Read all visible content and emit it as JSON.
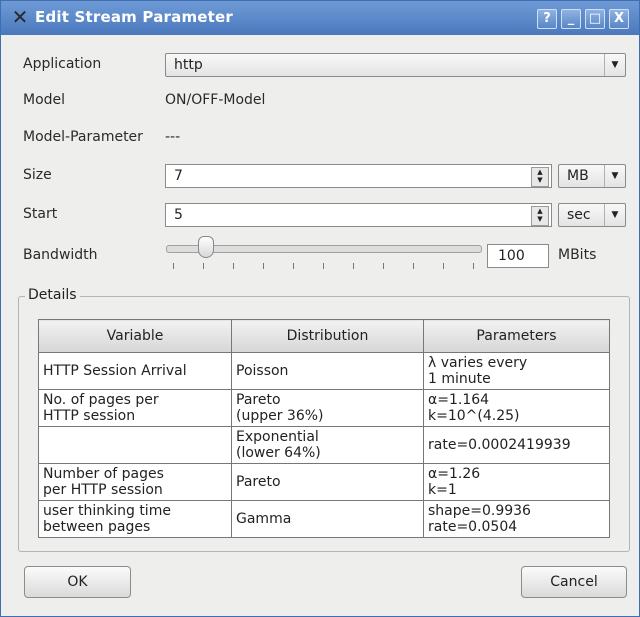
{
  "window": {
    "title": "Edit Stream Parameter",
    "controls": {
      "help": "?",
      "minimize": "_",
      "maximize": "□",
      "close": "X"
    }
  },
  "form": {
    "application": {
      "label": "Application",
      "value": "http"
    },
    "model": {
      "label": "Model",
      "value": "ON/OFF-Model"
    },
    "model_parameter": {
      "label": "Model-Parameter",
      "value": "---"
    },
    "size": {
      "label": "Size",
      "value": "7",
      "unit": "MB"
    },
    "start": {
      "label": "Start",
      "value": "5",
      "unit": "sec"
    },
    "bandwidth": {
      "label": "Bandwidth",
      "value": "100",
      "unit": "MBits",
      "slider_fraction": 0.12
    }
  },
  "details": {
    "title": "Details",
    "columns": [
      "Variable",
      "Distribution",
      "Parameters"
    ],
    "rows": [
      {
        "variable": [
          "HTTP Session Arrival"
        ],
        "distribution": [
          "Poisson"
        ],
        "parameters": [
          "λ varies every",
          "1 minute"
        ]
      },
      {
        "variable": [
          "No. of pages per",
          "HTTP session"
        ],
        "distribution": [
          "Pareto",
          "(upper 36%)"
        ],
        "parameters": [
          "α=1.164",
          "k=10^(4.25)"
        ]
      },
      {
        "variable": [
          ""
        ],
        "distribution": [
          "Exponential",
          "(lower 64%)"
        ],
        "parameters": [
          "rate=0.0002419939"
        ]
      },
      {
        "variable": [
          "Number of pages",
          "per HTTP session"
        ],
        "distribution": [
          "Pareto"
        ],
        "parameters": [
          "α=1.26",
          "k=1"
        ]
      },
      {
        "variable": [
          "user thinking time",
          "between pages"
        ],
        "distribution": [
          "Gamma"
        ],
        "parameters": [
          "shape=0.9936",
          "rate=0.0504"
        ]
      }
    ]
  },
  "buttons": {
    "ok": "OK",
    "cancel": "Cancel"
  },
  "colors": {
    "titlebar": "#4a79bd",
    "window_bg": "#eeeeec"
  }
}
